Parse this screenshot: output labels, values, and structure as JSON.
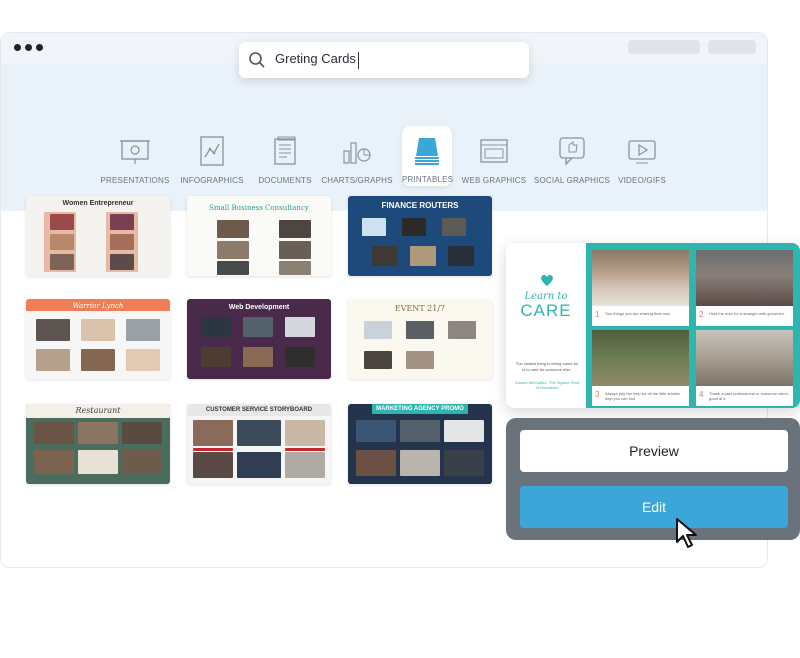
{
  "search": {
    "value": "Greting Cards"
  },
  "categories": [
    {
      "label": "PRESENTATIONS",
      "icon": "presentation-icon"
    },
    {
      "label": "INFOGRAPHICS",
      "icon": "infographic-icon"
    },
    {
      "label": "DOCUMENTS",
      "icon": "document-icon"
    },
    {
      "label": "CHARTS/GRAPHS",
      "icon": "chart-icon"
    },
    {
      "label": "PRINTABLES",
      "icon": "printer-icon",
      "active": true
    },
    {
      "label": "WEB GRAPHICS",
      "icon": "web-graphic-icon"
    },
    {
      "label": "SOCIAL GRAPHICS",
      "icon": "social-graphic-icon"
    },
    {
      "label": "VIDEO/GIFS",
      "icon": "video-icon"
    }
  ],
  "templates": [
    {
      "title": "Women Entrepreneur"
    },
    {
      "title": "Small Business Consultancy"
    },
    {
      "title": "FINANCE ROUTERS"
    },
    {
      "title": "Warrior Lynch"
    },
    {
      "title": "Web Development"
    },
    {
      "title": "EVENT 21/7"
    },
    {
      "title": "Restaurant"
    },
    {
      "title": "CUSTOMER SERVICE STORYBOARD"
    },
    {
      "title": "MARKETING AGENCY PROMO"
    }
  ],
  "preview_card": {
    "brand_line1": "Learn to",
    "brand_line2": "CARE",
    "quote": "The closest thing to being cared for is to care for someone else.",
    "signature": "Carson McCullers, The Square Root of Wonderful",
    "panels": [
      {
        "num": "1",
        "caption": "Two things you are sharing their own"
      },
      {
        "num": "2",
        "caption": "Hold the door for a stranger with groceries"
      },
      {
        "num": "3",
        "caption": "Always pay the help for all the little smaller help you can find"
      },
      {
        "num": "4",
        "caption": "Thank a paid professional or someone who's good at it"
      }
    ]
  },
  "actions": {
    "preview": "Preview",
    "edit": "Edit"
  },
  "colors": {
    "accent": "#3aa7d8",
    "teal": "#2eb6ae",
    "panel": "#6a727c",
    "band": "#e9f1f9"
  }
}
